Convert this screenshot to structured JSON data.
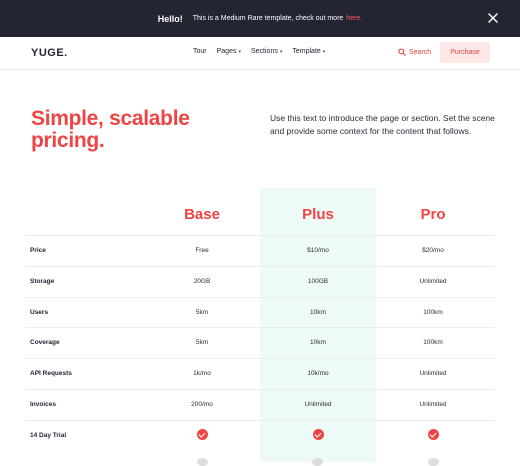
{
  "announcement": {
    "hello": "Hello!",
    "text": "This is a Medium Rare template, check out more",
    "link": "here."
  },
  "nav": {
    "logo": "YUGE.",
    "items": [
      "Tour",
      "Pages",
      "Sections",
      "Template"
    ],
    "search": "Search",
    "purchase": "Purchase"
  },
  "hero": {
    "title": "Simple, scalable pricing.",
    "text": "Use this text to introduce the page or section. Set the scene and provide some context for the content that follows."
  },
  "pricing": {
    "plans": [
      "Base",
      "Plus",
      "Pro"
    ],
    "rows": [
      {
        "label": "Price",
        "values": [
          "Free",
          "$10/mo",
          "$20/mo"
        ]
      },
      {
        "label": "Storage",
        "values": [
          "20GB",
          "100GB",
          "Unlimited"
        ]
      },
      {
        "label": "Users",
        "values": [
          "5km",
          "10km",
          "100km"
        ]
      },
      {
        "label": "Coverage",
        "values": [
          "5km",
          "10km",
          "100km"
        ]
      },
      {
        "label": "API Requests",
        "values": [
          "1k/mo",
          "10k/mo",
          "Unlimited"
        ]
      },
      {
        "label": "Invoices",
        "values": [
          "200/mo",
          "Unlimited",
          "Unlimited"
        ]
      },
      {
        "label": "14 Day Trial",
        "values": [
          "check",
          "check",
          "check"
        ]
      }
    ]
  },
  "colors": {
    "accent": "#ef4444",
    "dark": "#232533",
    "highlight": "#eefaf6"
  }
}
